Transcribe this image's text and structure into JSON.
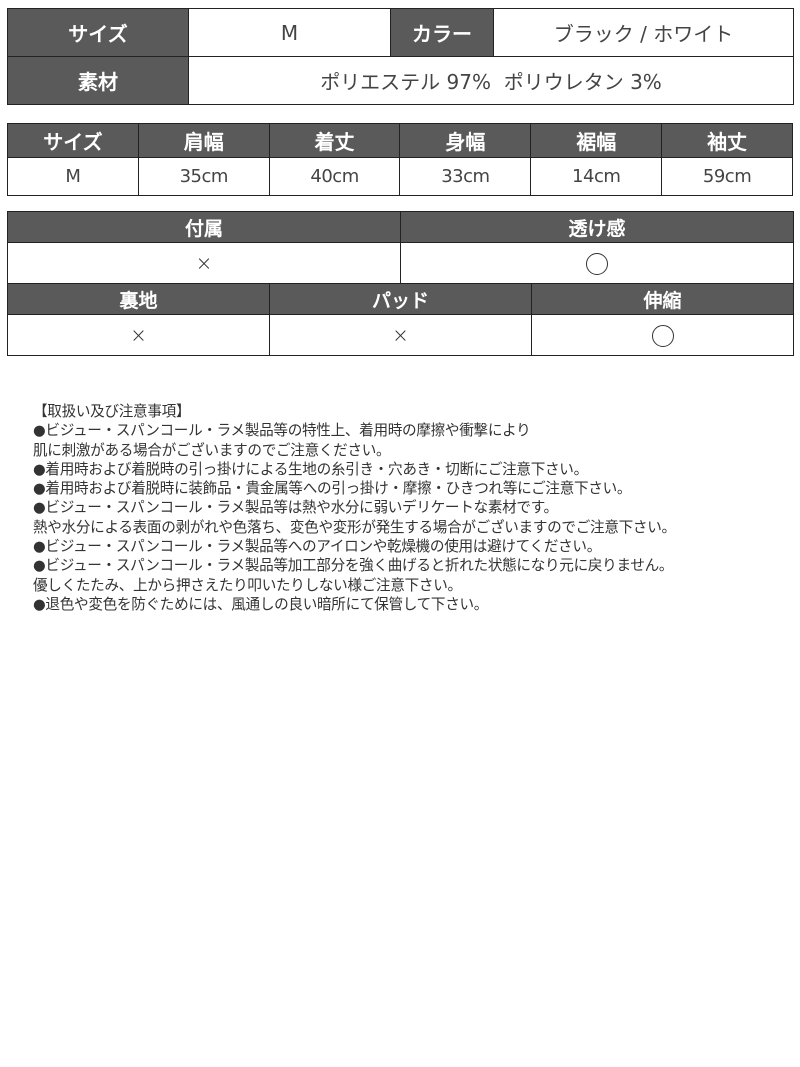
{
  "summary_table": {
    "size_label": "サイズ",
    "size_value": "M",
    "color_label": "カラー",
    "color_value": "ブラック / ホワイト",
    "material_label": "素材",
    "material_value": "ポリエステル 97%  ポリウレタン 3%"
  },
  "measurement_table": {
    "headers": [
      "サイズ",
      "肩幅",
      "着丈",
      "身幅",
      "裾幅",
      "袖丈"
    ],
    "values": [
      "M",
      "35cm",
      "40cm",
      "33cm",
      "14cm",
      "59cm"
    ]
  },
  "features_table": {
    "row1": [
      {
        "label": "付属",
        "value": "×",
        "icon": "cross-icon"
      },
      {
        "label": "透け感",
        "value": "○",
        "icon": "circle-icon"
      }
    ],
    "row2": [
      {
        "label": "裏地",
        "value": "×",
        "icon": "cross-icon"
      },
      {
        "label": "パッド",
        "value": "×",
        "icon": "cross-icon"
      },
      {
        "label": "伸縮",
        "value": "○",
        "icon": "circle-icon"
      }
    ]
  },
  "care_notes": {
    "title": "【取扱い及び注意事項】",
    "lines": [
      "●ビジュー・スパンコール・ラメ製品等の特性上、着用時の摩擦や衝撃により",
      "肌に刺激がある場合がございますのでご注意ください。",
      "●着用時および着脱時の引っ掛けによる生地の糸引き・穴あき・切断にご注意下さい。",
      "●着用時および着脱時に装飾品・貴金属等への引っ掛け・摩擦・ひきつれ等にご注意下さい。",
      "●ビジュー・スパンコール・ラメ製品等は熱や水分に弱いデリケートな素材です。",
      "熱や水分による表面の剥がれや色落ち、変色や変形が発生する場合がございますのでご注意下さい。",
      "●ビジュー・スパンコール・ラメ製品等へのアイロンや乾燥機の使用は避けてください。",
      "●ビジュー・スパンコール・ラメ製品等加工部分を強く曲げると折れた状態になり元に戻りません。",
      "優しくたたみ、上から押さえたり叩いたりしない様ご注意下さい。",
      "●退色や変色を防ぐためには、風通しの良い暗所にて保管して下さい。"
    ]
  },
  "colors": {
    "header_bg": "#5a5a5a",
    "header_text": "#ffffff",
    "border": "#222222",
    "body_text": "#333333"
  }
}
